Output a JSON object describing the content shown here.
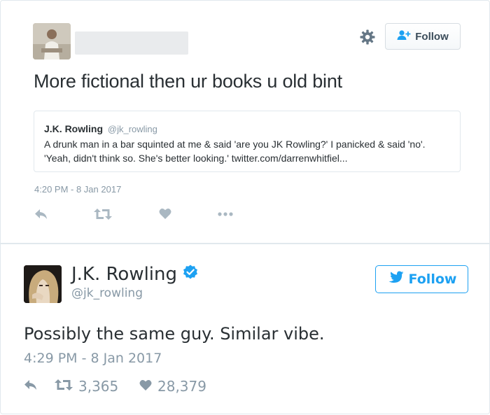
{
  "tweet1": {
    "author_name": "",
    "follow_label": "Follow",
    "text": "More fictional then ur books u old bint",
    "quote": {
      "name": "J.K. Rowling",
      "handle": "@jk_rowling",
      "text": "A drunk man in a bar squinted at me & said 'are you JK Rowling?' I panicked & said 'no'. 'Yeah, didn't think so. She's better looking.' twitter.com/darrenwhitfiel..."
    },
    "timestamp": "4:20 PM - 8 Jan 2017",
    "icons": {
      "settings": "gear-icon",
      "follow": "add-user-icon",
      "reply": "reply-icon",
      "retweet": "retweet-icon",
      "like": "heart-icon",
      "more": "more-icon"
    }
  },
  "tweet2": {
    "name": "J.K. Rowling",
    "handle": "@jk_rowling",
    "verified": true,
    "follow_label": "Follow",
    "text": "Possibly the same guy. Similar vibe.",
    "timestamp": "4:29 PM - 8 Jan 2017",
    "retweets": "3,365",
    "likes": "28,379",
    "icons": {
      "verified": "verified-badge-icon",
      "follow": "bird-icon",
      "reply": "reply-icon",
      "retweet": "retweet-icon",
      "like": "heart-icon"
    }
  },
  "colors": {
    "twitter_blue": "#1da1f2",
    "text_primary": "#292f33",
    "text_secondary": "#8899a6",
    "icon_grey": "#aab8c2",
    "border": "#e1e8ed"
  }
}
